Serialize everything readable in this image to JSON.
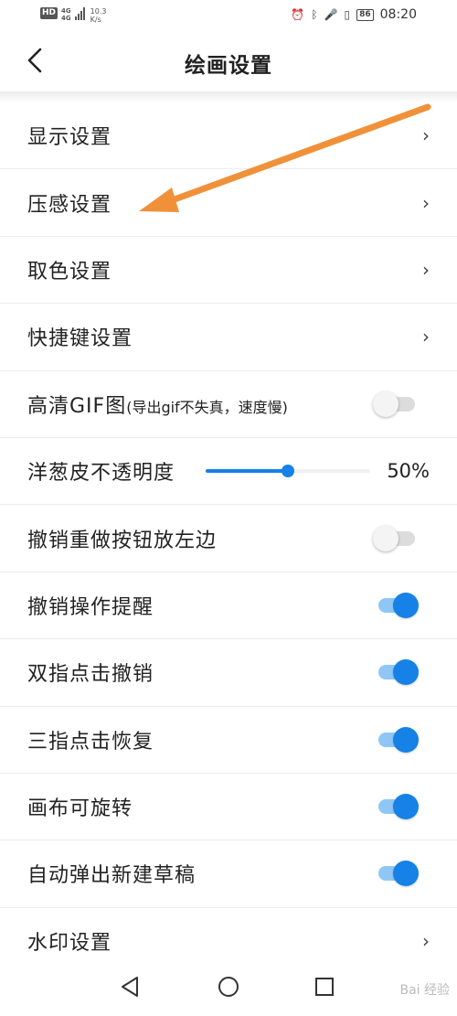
{
  "status_bar": {
    "hd": "HD",
    "net_top": "4G",
    "net_bottom": "4G",
    "speed_value": "10.3",
    "speed_unit": "K/s",
    "battery": "86",
    "time": "08:20"
  },
  "header": {
    "title": "绘画设置"
  },
  "settings": {
    "display": "显示设置",
    "pressure": "压感设置",
    "color_pick": "取色设置",
    "shortcut": "快捷键设置",
    "hd_gif": "高清GIF图",
    "hd_gif_note": "(导出gif不失真，速度慢)",
    "onion_opacity": "洋葱皮不透明度",
    "onion_opacity_value": "50%",
    "onion_opacity_fraction": 0.5,
    "undo_left": "撤销重做按钮放左边",
    "undo_reminder": "撤销操作提醒",
    "two_finger_undo": "双指点击撤销",
    "three_finger_redo": "三指点击恢复",
    "canvas_rotate": "画布可旋转",
    "auto_new_draft": "自动弹出新建草稿",
    "watermark": "水印设置"
  },
  "toggles": {
    "hd_gif": false,
    "undo_left": false,
    "undo_reminder": true,
    "two_finger_undo": true,
    "three_finger_redo": true,
    "canvas_rotate": true,
    "auto_new_draft": true
  },
  "navbar": {
    "watermark_text": "Bai 经验"
  },
  "colors": {
    "accent": "#1681e6",
    "accent_track": "#8ec7f5",
    "annotation_arrow": "#f0913a"
  }
}
